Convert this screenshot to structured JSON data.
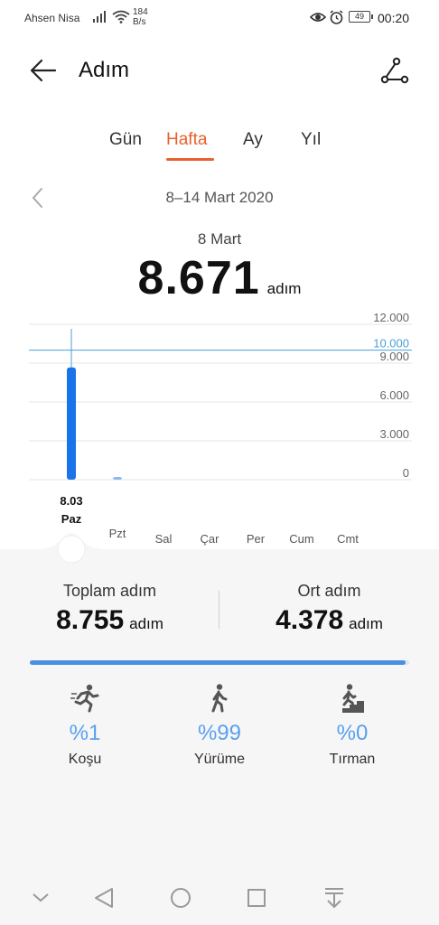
{
  "status_bar": {
    "carrier": "Ahsen  Nisa",
    "net_speed_value": "184",
    "net_speed_unit": "B/s",
    "battery": "49",
    "time": "00:20"
  },
  "header": {
    "title": "Adım"
  },
  "tabs": [
    {
      "label": "Gün",
      "active": false
    },
    {
      "label": "Hafta",
      "active": true
    },
    {
      "label": "Ay",
      "active": false
    },
    {
      "label": "Yıl",
      "active": false
    }
  ],
  "period": {
    "date_range": "8–14 Mart 2020",
    "selected_day": "8 Mart",
    "selected_steps": "8.671",
    "unit": "adım"
  },
  "chart_data": {
    "type": "bar",
    "categories": [
      "Paz",
      "Pzt",
      "Sal",
      "Çar",
      "Per",
      "Cum",
      "Cmt"
    ],
    "values": [
      8671,
      84,
      0,
      0,
      0,
      0,
      0
    ],
    "y_ticks": [
      "12.000",
      "9.000",
      "6.000",
      "3.000",
      "0"
    ],
    "y_tick_values": [
      12000,
      9000,
      6000,
      3000,
      0
    ],
    "ylim": [
      0,
      12000
    ],
    "goal_label": "10.000",
    "goal_value": 10000,
    "selected_index": 0,
    "selected_date_label": "8.03",
    "bar_color": "#1a73e8",
    "goal_color": "#4a9fd8"
  },
  "summary": {
    "total_label": "Toplam adım",
    "total_value": "8.755",
    "avg_label": "Ort adım",
    "avg_value": "4.378",
    "unit": "adım",
    "progress_fraction": 0.99
  },
  "activities": [
    {
      "icon": "running-icon",
      "percent": "%1",
      "label": "Koşu"
    },
    {
      "icon": "walking-icon",
      "percent": "%99",
      "label": "Yürüme"
    },
    {
      "icon": "climbing-icon",
      "percent": "%0",
      "label": "Tırman"
    }
  ],
  "colors": {
    "accent": "#e8612c",
    "bar": "#1a73e8",
    "activity_text": "#5aa0ee"
  }
}
